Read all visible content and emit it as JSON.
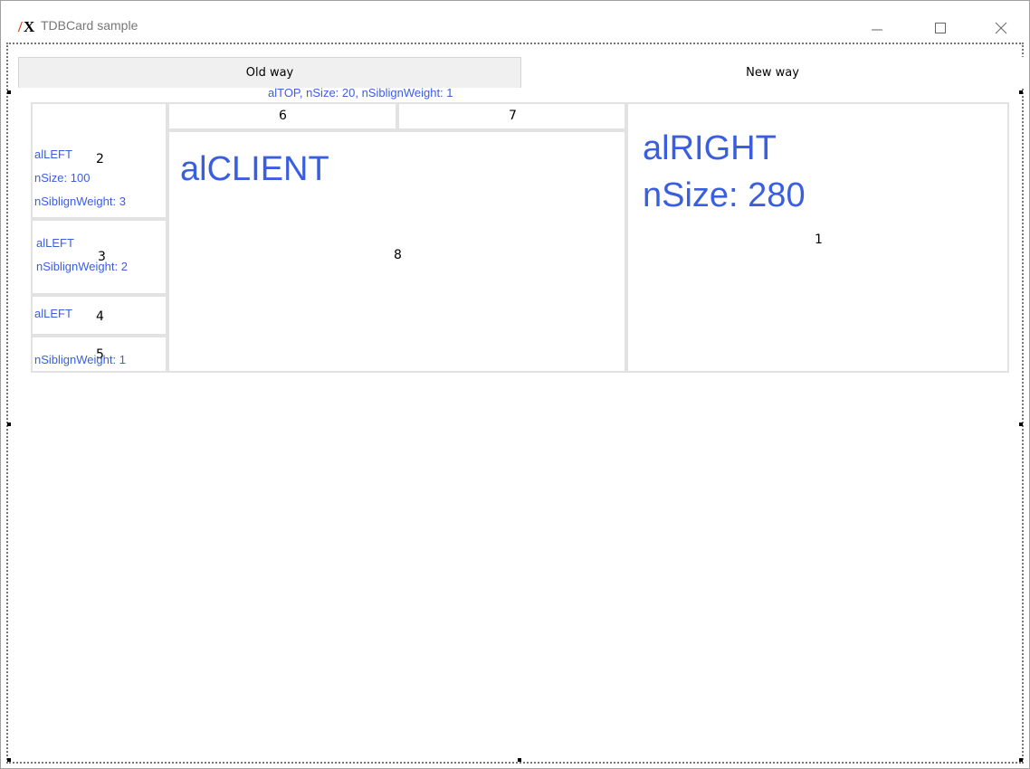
{
  "window": {
    "title": "TDBCard sample",
    "icon": "app-logo-icon",
    "controls": [
      "minimize-icon",
      "maximize-icon",
      "close-icon"
    ]
  },
  "tabs": [
    {
      "label": "Old way",
      "selected": false
    },
    {
      "label": "New way",
      "selected": true
    }
  ],
  "top_caption": "alTOP,  nSize:  20,  nSiblignWeight:  1",
  "panels": {
    "p1": {
      "number": "1",
      "line1": "alRIGHT",
      "line2": "nSize: 280"
    },
    "p2": {
      "number": "2",
      "line1": "alLEFT",
      "line2": "nSize:  100",
      "line3": "nSiblignWeight:  3"
    },
    "p3": {
      "number": "3",
      "line1": "alLEFT",
      "line2": "nSiblignWeight:  2"
    },
    "p4": {
      "number": "4",
      "line1": "alLEFT"
    },
    "p5": {
      "number": "5",
      "line1": "nSiblignWeight:  1"
    },
    "p6": {
      "number": "6"
    },
    "p7": {
      "number": "7"
    },
    "p8": {
      "number": "8",
      "line1": "alCLIENT"
    }
  },
  "colors": {
    "accent_text": "#3a5ee0",
    "panel_border": "#e2e2e2",
    "tab_inactive": "#f0f0f0"
  }
}
